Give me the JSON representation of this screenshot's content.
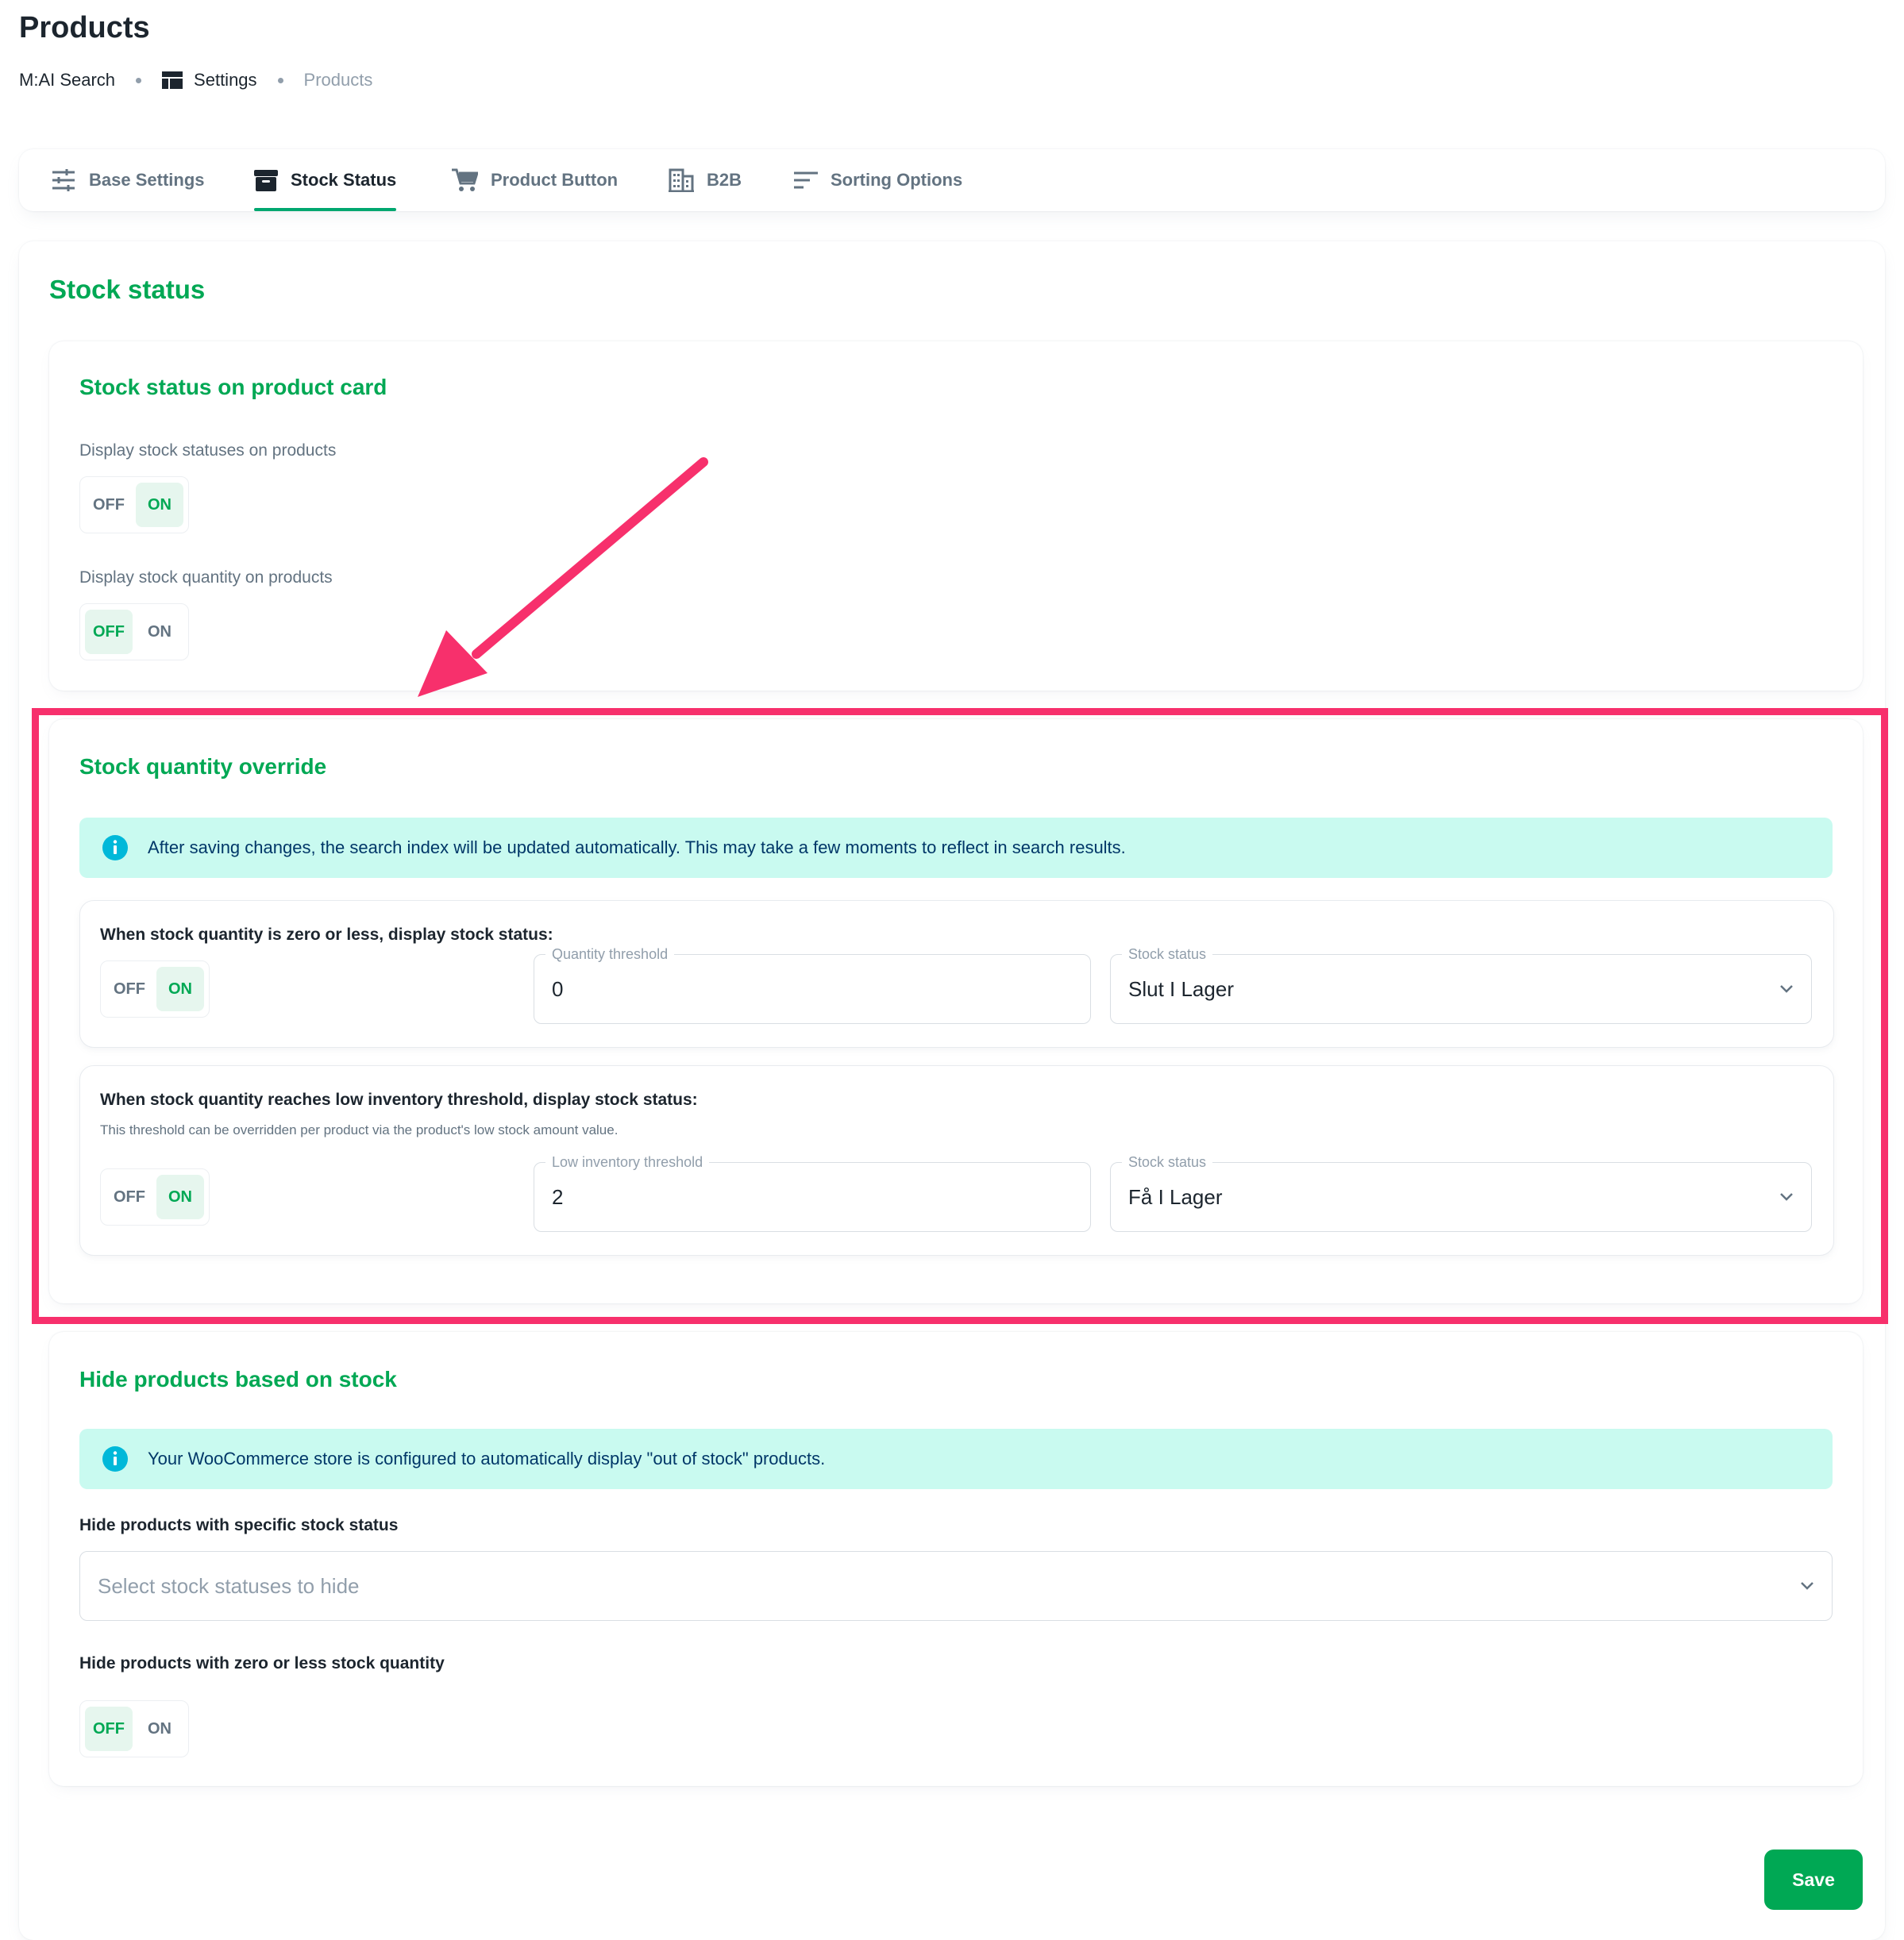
{
  "page": {
    "title": "Products"
  },
  "breadcrumb": {
    "app": "M:AI Search",
    "settings": "Settings",
    "current": "Products"
  },
  "tabs": [
    {
      "label": "Base Settings",
      "icon": "sliders-icon",
      "active": false
    },
    {
      "label": "Stock Status",
      "icon": "archive-box-icon",
      "active": true
    },
    {
      "label": "Product Button",
      "icon": "cart-icon",
      "active": false
    },
    {
      "label": "B2B",
      "icon": "building-icon",
      "active": false
    },
    {
      "label": "Sorting Options",
      "icon": "sort-lines-icon",
      "active": false
    }
  ],
  "main": {
    "heading": "Stock status"
  },
  "product_card": {
    "heading": "Stock status on product card",
    "display_statuses_label": "Display stock statuses on products",
    "display_statuses": {
      "off": "OFF",
      "on": "ON",
      "selected": "on"
    },
    "display_quantity_label": "Display stock quantity on products",
    "display_quantity": {
      "off": "OFF",
      "on": "ON",
      "selected": "off"
    }
  },
  "override": {
    "heading": "Stock quantity override",
    "alert": "After saving changes, the search index will be updated automatically. This may take a few moments to reflect in search results.",
    "zero": {
      "label": "When stock quantity is zero or less, display stock status:",
      "toggle": {
        "off": "OFF",
        "on": "ON",
        "selected": "on"
      },
      "threshold_label": "Quantity threshold",
      "threshold_value": "0",
      "status_label": "Stock status",
      "status_value": "Slut I Lager"
    },
    "low": {
      "label": "When stock quantity reaches low inventory threshold, display stock status:",
      "note": "This threshold can be overridden per product via the product's low stock amount value.",
      "toggle": {
        "off": "OFF",
        "on": "ON",
        "selected": "on"
      },
      "threshold_label": "Low inventory threshold",
      "threshold_value": "2",
      "status_label": "Stock status",
      "status_value": "Få I Lager"
    }
  },
  "hide": {
    "heading": "Hide products based on stock",
    "alert": "Your WooCommerce store is configured to automatically display \"out of stock\" products.",
    "specific_label": "Hide products with specific stock status",
    "specific_placeholder": "Select stock statuses to hide",
    "zero_label": "Hide products with zero or less stock quantity",
    "zero_toggle": {
      "off": "OFF",
      "on": "ON",
      "selected": "off"
    }
  },
  "actions": {
    "save": "Save"
  },
  "colors": {
    "accent": "#00a854",
    "highlight": "#f7306c",
    "info_bg": "#c9faf0",
    "info_icon": "#00b8d9"
  }
}
